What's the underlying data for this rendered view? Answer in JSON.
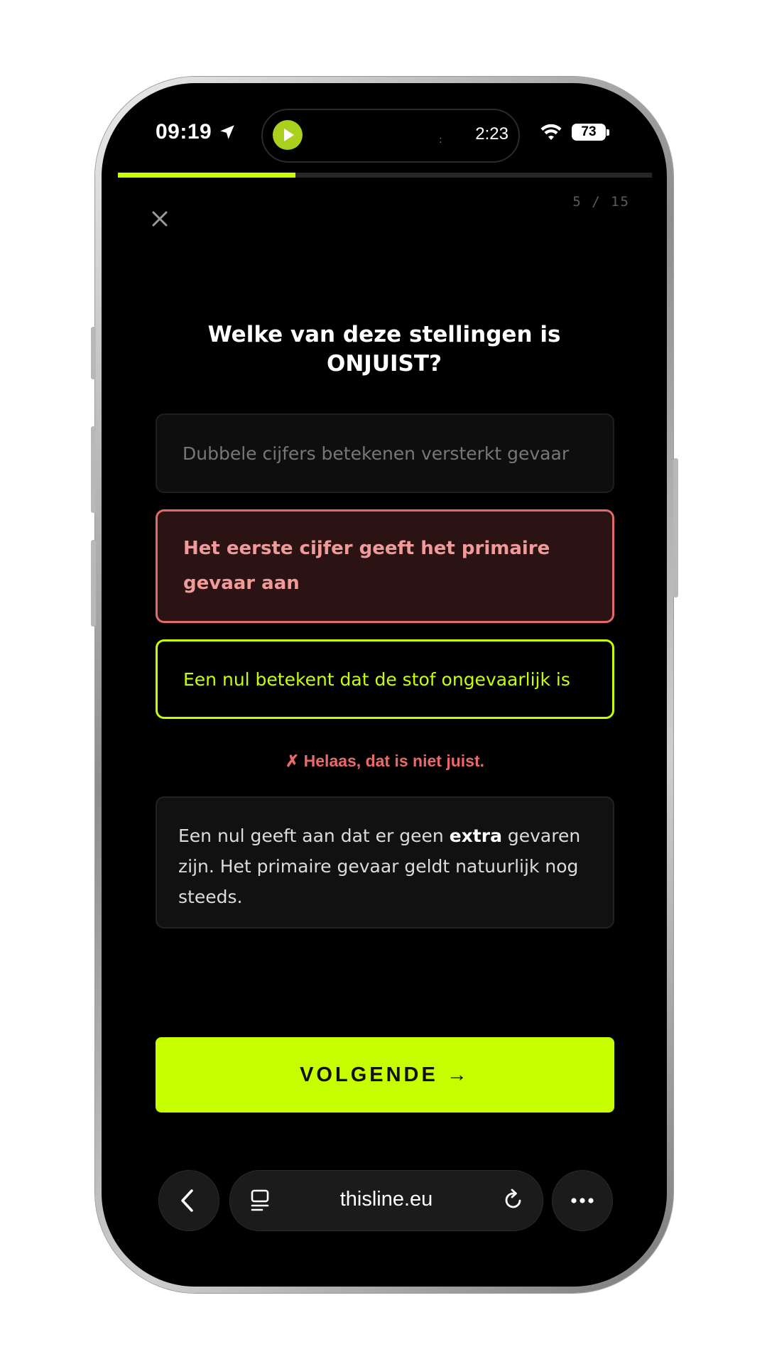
{
  "status_bar": {
    "time": "09:19",
    "media_timer": "2:23",
    "media_dots": ":",
    "battery": "73"
  },
  "quiz": {
    "progress": {
      "current": 5,
      "total": 15,
      "label": "5 / 15",
      "fraction": 0.333
    },
    "question": "Welke van deze stellingen is ONJUIST?",
    "options": [
      {
        "text": "Dubbele cijfers betekenen versterkt gevaar",
        "state": "neutral"
      },
      {
        "text": "Het eerste cijfer geeft het primaire gevaar aan",
        "state": "selected-wrong"
      },
      {
        "text": "Een nul betekent dat de stof ongevaarlijk is",
        "state": "correct"
      }
    ],
    "feedback": "✗ Helaas, dat is niet juist.",
    "explanation": {
      "before": "Een nul geeft aan dat er geen ",
      "emphasis": "extra",
      "after": " gevaren zijn. Het primaire gevaar geldt natuurlijk nog steeds."
    },
    "next_label": "VOLGENDE →"
  },
  "browser": {
    "url": "thisline.eu"
  },
  "colors": {
    "accent": "#c8ff00",
    "wrong": "#e36a6a",
    "background": "#000000"
  }
}
